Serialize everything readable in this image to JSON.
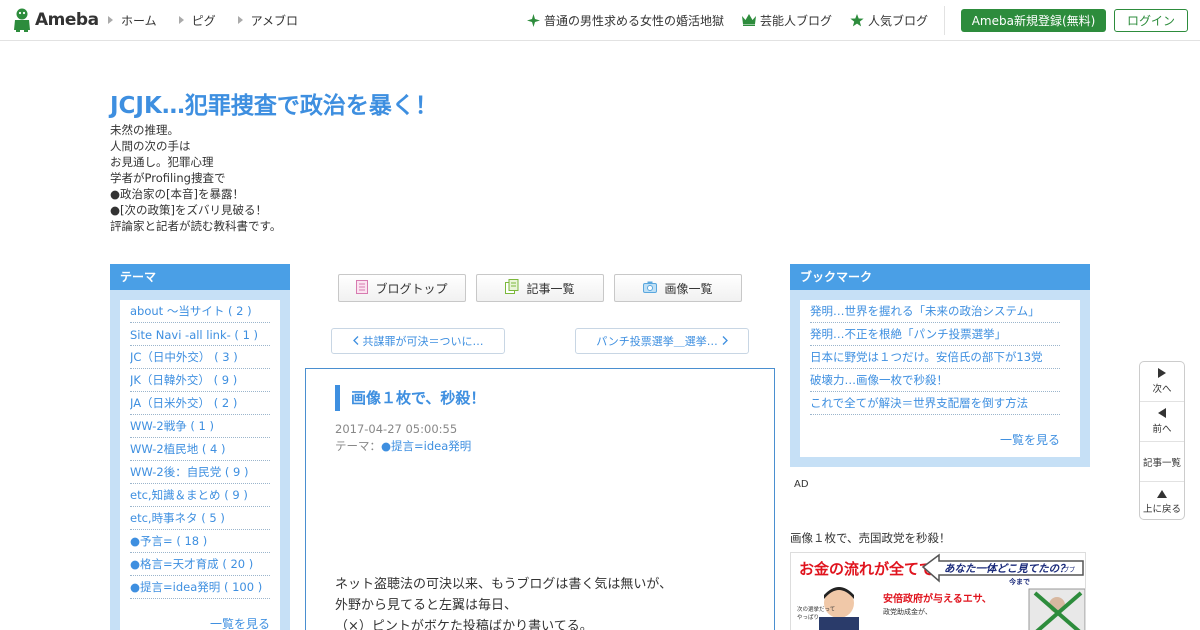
{
  "topbar": {
    "logo_text": "Ameba",
    "nav": [
      "ホーム",
      "ピグ",
      "アメブロ"
    ],
    "promos": [
      {
        "label": "普通の男性求める女性の婚活地獄",
        "icon": "sparkle-icon"
      },
      {
        "label": "芸能人ブログ",
        "icon": "crown-icon"
      },
      {
        "label": "人気ブログ",
        "icon": "star-icon"
      }
    ],
    "register_label": "Ameba新規登録(無料)",
    "login_label": "ログイン"
  },
  "header": {
    "title": "JCJK…犯罪捜査で政治を暴く！",
    "description": [
      "未然の推理。",
      "人間の次の手は",
      "お見通し。犯罪心理",
      "学者がProfiling捜査で",
      "●政治家の[本音]を暴露！",
      "●[次の政策]をズバリ見破る！",
      "評論家と記者が読む教科書です。"
    ]
  },
  "theme_box": {
    "title": "テーマ",
    "items": [
      "about ～当サイト ( 2 )",
      "Site Navi -all link- ( 1 )",
      "JC（日中外交） ( 3 )",
      "JK（日韓外交） ( 9 )",
      "JA（日米外交） ( 2 )",
      "WW-2戦争 ( 1 )",
      "WW-2植民地 ( 4 )",
      "WW-2後：自民党 ( 9 )",
      "etc,知識＆まとめ ( 9 )",
      "etc,時事ネタ ( 5 )",
      "●予言= ( 18 )",
      "●格言=天才育成 ( 20 )",
      "●提言=idea発明 ( 100 )"
    ],
    "more_label": "一覧を見る"
  },
  "blog_nav": {
    "top_label": "ブログトップ",
    "entries_label": "記事一覧",
    "images_label": "画像一覧"
  },
  "pager": {
    "prev_label": "共謀罪が可決＝ついに…",
    "next_label": "パンチ投票選挙＿選挙…"
  },
  "article": {
    "title": "画像１枚で、秒殺！",
    "date": "2017-04-27 05:00:55",
    "theme_prefix": "テーマ：",
    "theme_link": "●提言=idea発明",
    "body": [
      "ネット盗聴法の可決以来、もうブログは書く気は無いが、",
      "外野から見てると左翼は毎日、",
      "（×）ピントがボケた投稿ばかり書いてる。"
    ]
  },
  "bookmark_box": {
    "title": "ブックマーク",
    "items": [
      "発明…世界を握れる「未来の政治システム」",
      "発明…不正を根絶「パンチ投票選挙」",
      "日本に野党は１つだけ。安倍氏の部下が13党",
      "破壊力…画像一枚で秒殺！",
      "これで全てが解決＝世界支配層を倒す方法"
    ],
    "more_label": "一覧を見る"
  },
  "ad": {
    "label": "AD",
    "caption": "画像１枚で、売国政党を秒殺！",
    "img_text_left": "お金の流れが全てです。",
    "img_text_right": "あなた一体どこ見てたの？",
    "img_small": "ププ",
    "img_small2": "今まで",
    "img_sub": "安倍政府が与えるエサ、",
    "img_sub2": "政党助成金が、",
    "img_left_note": "次の選挙だって",
    "img_left_note2": "やっぱり"
  },
  "side_nav": {
    "next_label": "次へ",
    "prev_label": "前へ",
    "list_label": "記事一覧",
    "top_label": "上に戻る"
  },
  "colors": {
    "accent": "#3e8fe0",
    "box_bg": "#c6e0f6",
    "box_head": "#4a9fe6",
    "ameba_green": "#2d8c3c"
  }
}
